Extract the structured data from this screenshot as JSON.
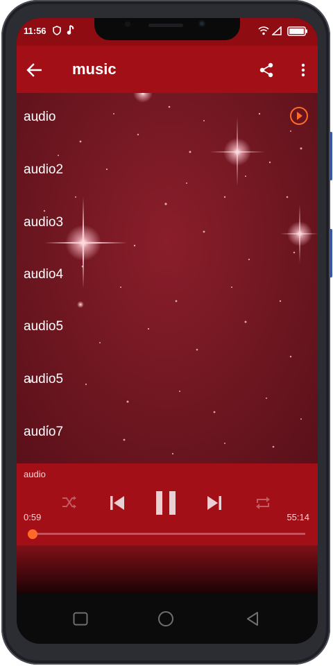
{
  "status": {
    "time": "11:56"
  },
  "appbar": {
    "title": "music"
  },
  "tracks": [
    "audio",
    "audio2",
    "audio3",
    "audio4",
    "audio5",
    "audio5",
    "audio7"
  ],
  "player": {
    "now_playing": "audio",
    "elapsed": "0:59",
    "duration": "55:14",
    "progress": 0.018
  },
  "colors": {
    "appbar": "#a30f17",
    "statusbar": "#8f0c12",
    "accent": "#ff6a2a"
  },
  "icons": {
    "back": "arrow-left-icon",
    "share": "share-icon",
    "more": "more-vertical-icon",
    "play": "play-circle-icon",
    "shuffle": "shuffle-icon",
    "previous": "skip-previous-icon",
    "pause": "pause-icon",
    "next": "skip-next-icon",
    "repeat": "repeat-icon"
  }
}
